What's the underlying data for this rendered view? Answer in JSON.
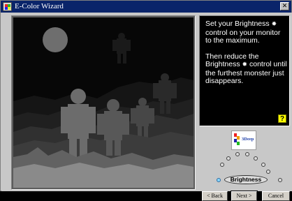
{
  "window": {
    "title": "E-Color Wizard",
    "close_glyph": "✕"
  },
  "instructions": {
    "line1_before": "Set your Brightness",
    "line1_after": "control on your monitor to the maximum.",
    "line2_before": "Then reduce the Brightness",
    "line2_after": "control until the furthest monster just disappears.",
    "icon": "brightness-sun-icon",
    "sun_glyph": "✸"
  },
  "help_button": {
    "label": "?",
    "color": "#ffff00"
  },
  "logo": {
    "text": "3Deep"
  },
  "control_selector": {
    "selected_label": "Brightness",
    "dot_count": 9,
    "active_dot": 1,
    "active_color": "#8ad8ff"
  },
  "buttons": {
    "back": "< Back",
    "next": "Next >",
    "cancel": "Cancel"
  },
  "colors": {
    "titlebar": "#0a246a",
    "window_face": "#c8c8c8",
    "panel_background": "#000000"
  }
}
